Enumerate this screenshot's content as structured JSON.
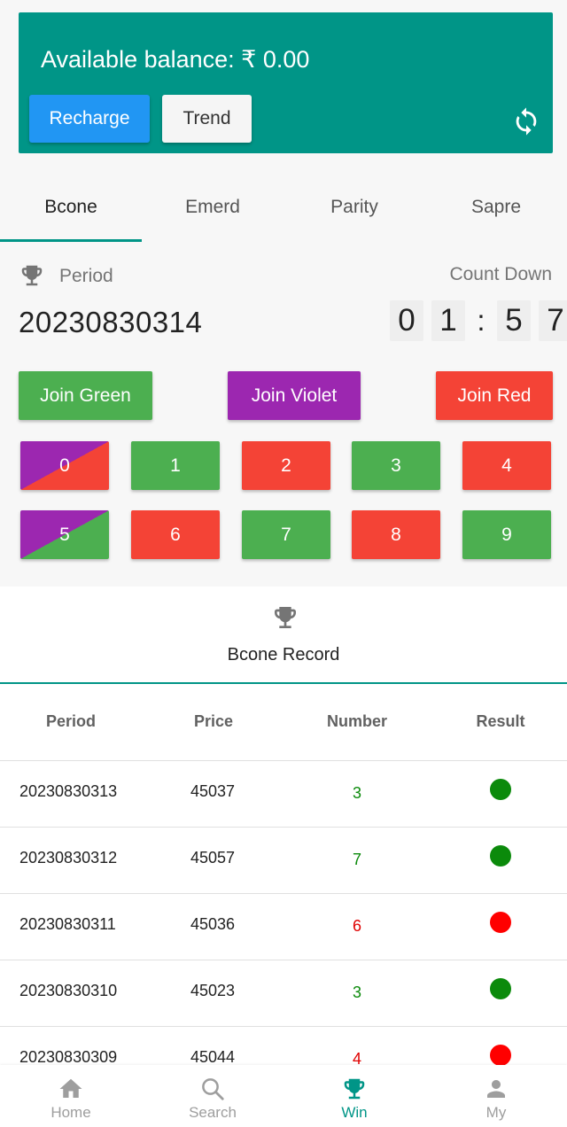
{
  "balance": {
    "text": "Available balance: ₹ 0.00",
    "recharge_label": "Recharge",
    "trend_label": "Trend",
    "refresh_icon": "refresh-icon"
  },
  "tabs": [
    {
      "label": "Bcone",
      "active": true
    },
    {
      "label": "Emerd",
      "active": false
    },
    {
      "label": "Parity",
      "active": false
    },
    {
      "label": "Sapre",
      "active": false
    }
  ],
  "period": {
    "label": "Period",
    "value": "20230830314",
    "countdown_label": "Count Down",
    "timer": [
      "0",
      "1",
      ":",
      "5",
      "7"
    ]
  },
  "join": {
    "green": "Join Green",
    "violet": "Join Violet",
    "red": "Join Red"
  },
  "numbers": [
    "0",
    "1",
    "2",
    "3",
    "4",
    "5",
    "6",
    "7",
    "8",
    "9"
  ],
  "record": {
    "title": "Bcone Record",
    "headers": [
      "Period",
      "Price",
      "Number",
      "Result"
    ],
    "rows": [
      {
        "period": "20230830313",
        "price": "45037",
        "number": "3",
        "result": "green"
      },
      {
        "period": "20230830312",
        "price": "45057",
        "number": "7",
        "result": "green"
      },
      {
        "period": "20230830311",
        "price": "45036",
        "number": "6",
        "result": "red"
      },
      {
        "period": "20230830310",
        "price": "45023",
        "number": "3",
        "result": "green"
      },
      {
        "period": "20230830309",
        "price": "45044",
        "number": "4",
        "result": "red"
      }
    ]
  },
  "nav": [
    {
      "label": "Home",
      "icon": "home-icon",
      "active": false
    },
    {
      "label": "Search",
      "icon": "search-icon",
      "active": false
    },
    {
      "label": "Win",
      "icon": "trophy-icon",
      "active": true
    },
    {
      "label": "My",
      "icon": "person-icon",
      "active": false
    }
  ],
  "colors": {
    "teal": "#009587",
    "green": "#4caf50",
    "red": "#f44336",
    "violet": "#9c27b0",
    "blue": "#2196f3",
    "result_green": "#0b8a0b",
    "result_red": "#ff0000"
  }
}
